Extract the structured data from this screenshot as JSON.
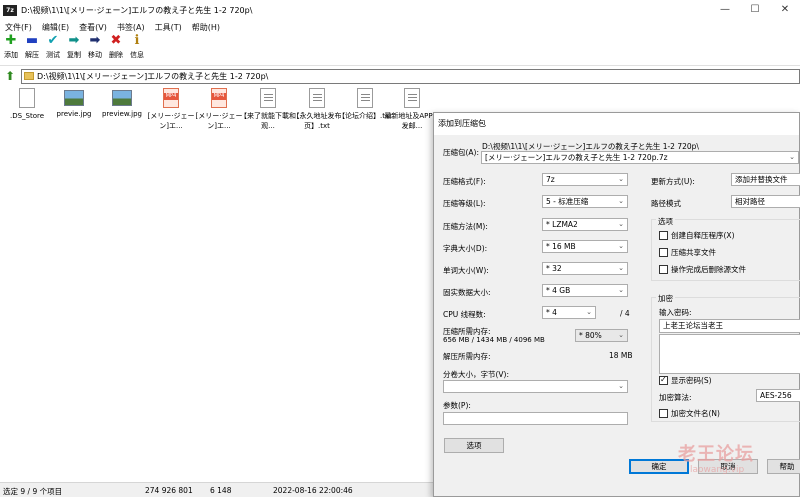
{
  "window": {
    "title": "D:\\视频\\1\\1\\[メリー·ジェーン]エルフの教え子と先生 1-2 720p\\",
    "app_icon": "7-zip-icon",
    "controls": [
      "—",
      "☐",
      "✕"
    ]
  },
  "menu": [
    "文件(F)",
    "编辑(E)",
    "查看(V)",
    "书签(A)",
    "工具(T)",
    "帮助(H)"
  ],
  "toolbar": [
    {
      "label": "添加",
      "icon": "add-icon",
      "glyph": "✚",
      "color": "#20a020"
    },
    {
      "label": "解压",
      "icon": "extract-icon",
      "glyph": "▬",
      "color": "#2040c0"
    },
    {
      "label": "测试",
      "icon": "test-icon",
      "glyph": "✔",
      "color": "#10a0b0"
    },
    {
      "label": "复制",
      "icon": "copy-icon",
      "glyph": "➡",
      "color": "#10908a"
    },
    {
      "label": "移动",
      "icon": "move-icon",
      "glyph": "➡",
      "color": "#203070"
    },
    {
      "label": "删除",
      "icon": "delete-icon",
      "glyph": "✖",
      "color": "#d02020"
    },
    {
      "label": "信息",
      "icon": "info-icon",
      "glyph": "ℹ",
      "color": "#b08010"
    }
  ],
  "address": "D:\\视频\\1\\1\\[メリー·ジェーン]エルフの教え子と先生 1-2 720p\\",
  "files": [
    {
      "name": ".DS_Store",
      "type": "generic"
    },
    {
      "name": "previe.jpg",
      "type": "img"
    },
    {
      "name": "preview.jpg",
      "type": "img"
    },
    {
      "name": "[メリー·ジェーン]エ...",
      "type": "mp4"
    },
    {
      "name": "[メリー·ジェーン]エ...",
      "type": "mp4"
    },
    {
      "name": "【来了就能下載和观...",
      "type": "txt"
    },
    {
      "name": "【永久地址发布页】.txt",
      "type": "txt"
    },
    {
      "name": "【论坛介绍】.txt",
      "type": "txt"
    },
    {
      "name": "最新地址及APP请发邮...",
      "type": "txt"
    }
  ],
  "mp4_badge": "MP4",
  "status": {
    "selected": "选定 9 / 9 个项目",
    "size": "274 926 801",
    "packed": "6 148",
    "modified": "2022-08-16 22:00:46"
  },
  "dialog": {
    "title": "添加到压缩包",
    "archive_label": "压缩包(A):",
    "archive_dir": "D:\\视频\\1\\1\\[メリー·ジェーン]エルフの教え子と先生 1-2 720p\\",
    "archive_name": "[メリー·ジェーン]エルフの教え子と先生 1-2 720p.7z",
    "left": [
      {
        "label": "压缩格式(F):",
        "value": "7z"
      },
      {
        "label": "压缩等级(L):",
        "value": "5 - 标准压缩"
      },
      {
        "label": "压缩方法(M):",
        "value": "* LZMA2"
      },
      {
        "label": "字典大小(D):",
        "value": "* 16 MB"
      },
      {
        "label": "单词大小(W):",
        "value": "* 32"
      },
      {
        "label": "固实数据大小:",
        "value": "* 4 GB"
      }
    ],
    "cpu_label": "CPU 线程数:",
    "cpu_value": "* 4",
    "cpu_total": "/ 4",
    "mem_label": "压缩所需内存:",
    "mem_detail": "656 MB / 1434 MB / 4096 MB",
    "mem_percent": "* 80%",
    "decomp_label": "解压所需内存:",
    "decomp_value": "18 MB",
    "split_label": "分卷大小，字节(V):",
    "split_value": "",
    "params_label": "参数(P):",
    "params_value": "",
    "options_button": "选项",
    "update_label": "更新方式(U):",
    "update_value": "添加并替换文件",
    "path_label": "路径模式",
    "path_value": "相对路径",
    "options_title": "选项",
    "options": [
      {
        "label": "创建自释压程序(X)",
        "checked": false
      },
      {
        "label": "压缩共享文件",
        "checked": false
      },
      {
        "label": "操作完成后删除源文件",
        "checked": false
      }
    ],
    "encrypt_title": "加密",
    "password_label": "输入密码:",
    "password_value": "上老王论坛当老王",
    "show_password": {
      "label": "显示密码(S)",
      "checked": true
    },
    "encrypt_method_label": "加密算法:",
    "encrypt_method_value": "AES-256",
    "encrypt_names": {
      "label": "加密文件名(N)",
      "checked": false
    },
    "ok": "确定",
    "cancel": "取消",
    "help": "帮助"
  },
  "watermark": {
    "main": "老王论坛",
    "sub": "laowang.vip"
  }
}
